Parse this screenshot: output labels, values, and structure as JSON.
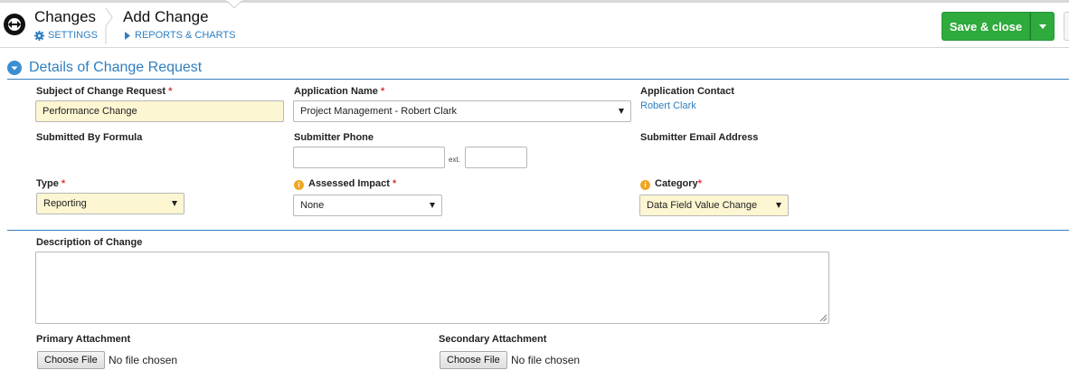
{
  "header": {
    "breadcrumb_root": "Changes",
    "breadcrumb_current": "Add Change",
    "settings_label": "SETTINGS",
    "reports_label": "REPORTS & CHARTS",
    "save_label": "Save & close",
    "accent_green": "#2eab3c",
    "link_blue": "#2f7fc1"
  },
  "section": {
    "title": "Details of Change Request"
  },
  "form": {
    "subject": {
      "label": "Subject of Change Request",
      "required": "*",
      "value": "Performance Change"
    },
    "application_name": {
      "label": "Application Name",
      "required": "*",
      "value": "Project Management - Robert Clark"
    },
    "application_contact": {
      "label": "Application Contact",
      "value": "Robert Clark"
    },
    "submitted_by": {
      "label": "Submitted By Formula"
    },
    "submitter_phone": {
      "label": "Submitter Phone",
      "value": "",
      "ext_label": "ext.",
      "ext_value": ""
    },
    "submitter_email": {
      "label": "Submitter Email Address"
    },
    "type": {
      "label": "Type",
      "required": "*",
      "value": "Reporting"
    },
    "assessed_impact": {
      "label": "Assessed Impact",
      "required": "*",
      "value": "None"
    },
    "category": {
      "label": "Category",
      "required": "*",
      "value": "Data Field Value Change"
    },
    "description": {
      "label": "Description of Change",
      "value": ""
    },
    "primary_attachment": {
      "label": "Primary Attachment",
      "button": "Choose File",
      "status": "No file chosen"
    },
    "secondary_attachment": {
      "label": "Secondary Attachment",
      "button": "Choose File",
      "status": "No file chosen"
    }
  },
  "icons": [
    "app-logo-icon",
    "gear-icon",
    "play-icon",
    "chevron-down-icon",
    "collapse-icon",
    "info-icon",
    "select-arrow-icon",
    "resize-handle-icon"
  ]
}
